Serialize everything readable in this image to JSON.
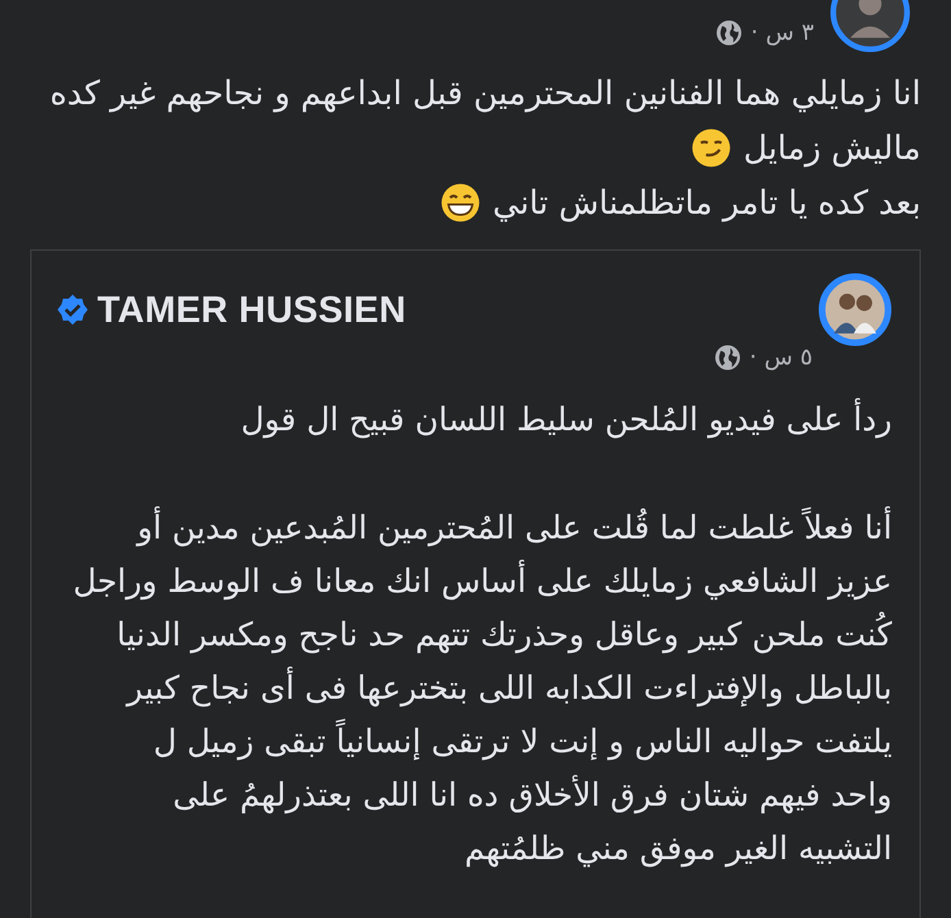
{
  "post": {
    "timestamp": "٣ س ·",
    "lines": [
      {
        "kind": "plain",
        "text": "انا زمايلي هما الفنانين المحترمين قبل ابداعهم و نجاحهم غير كده"
      },
      {
        "kind": "smirk",
        "text": "ماليش زمايل"
      },
      {
        "kind": "grin",
        "text": "بعد كده يا تامر ماتظلمناش تاني"
      }
    ]
  },
  "shared_post": {
    "author": "TAMER HUSSIEN",
    "verified": true,
    "timestamp": "٥ س ·",
    "paragraphs": [
      "ردأ على فيديو المُلحن سليط اللسان  قبيح ال قول",
      "أنا فعلاً غلطت لما قُلت على المُحترمين المُبدعين مدين أو\nعزيز الشافعي  زمايلك  على أساس انك معانا ف الوسط وراجل\nكُنت ملحن كبير وعاقل وحذرتك تتهم حد ناجح ومكسر الدنيا\nبالباطل والإفتراءت الكدابه  اللى بتخترعها فى أى نجاح كبير\nيلتفت حواليه الناس و إنت  لا ترتقى إنسانياً تبقى زميل ل\nواحد فيهم شتان فرق الأخلاق ده انا اللى بعتذرلهمُ  على\nالتشبيه الغير موفق مني ظلمُتهم"
    ]
  }
}
